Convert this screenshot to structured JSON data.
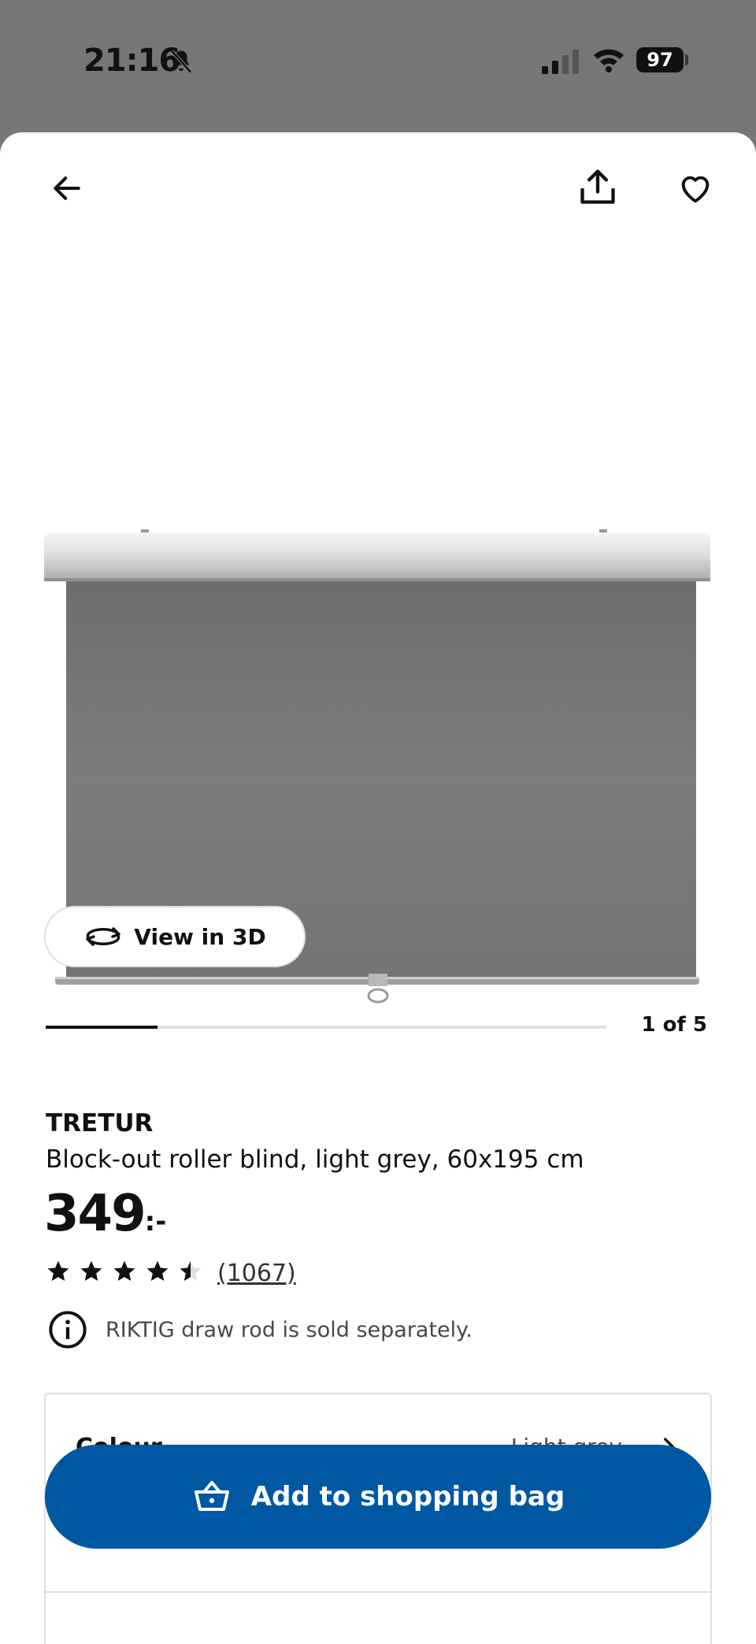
{
  "status_bar": {
    "time": "21:16",
    "battery": "97"
  },
  "gallery": {
    "view_3d_label": "View in 3D",
    "page_counter": "1 of 5",
    "progress": 0.2
  },
  "product": {
    "name": "TRETUR",
    "description": "Block-out roller blind, light grey, 60x195 cm",
    "price": "349",
    "price_suffix": ":-",
    "rating": 4.5,
    "review_count": "(1067)",
    "info": "RIKTIG draw rod is sold separately."
  },
  "colour": {
    "label": "Colour",
    "value": "Light grey"
  },
  "cta": {
    "add_to_bag_label": "Add to shopping bag"
  },
  "colors": {
    "brand_blue": "#0058a3"
  },
  "icons": [
    "bell-off-icon",
    "signal-icon",
    "wifi-icon",
    "battery-icon",
    "back-arrow-icon",
    "share-icon",
    "heart-icon",
    "rotate-3d-icon",
    "star-icon",
    "info-icon",
    "chevron-right-icon",
    "basket-icon"
  ]
}
